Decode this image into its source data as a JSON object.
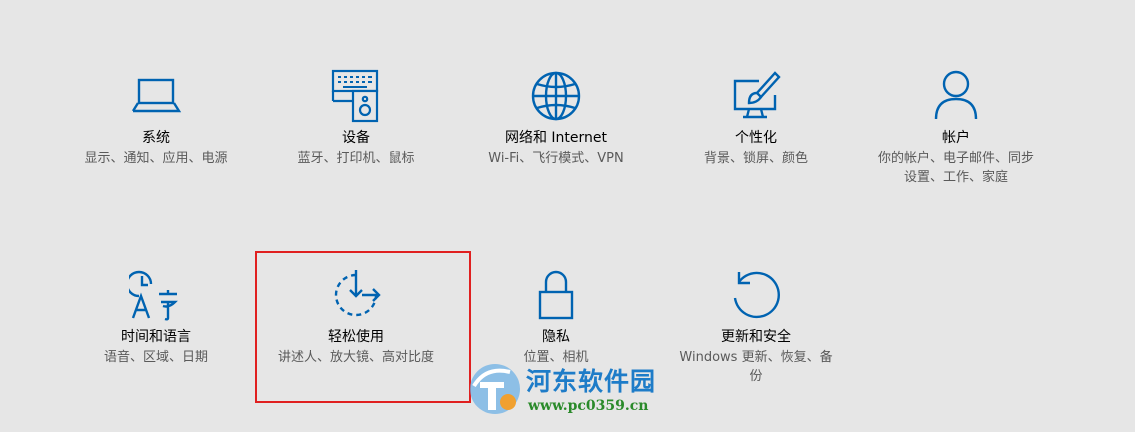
{
  "accent_color": "#0063b1",
  "settings": {
    "system": {
      "icon": "laptop-icon",
      "title": "系统",
      "desc": "显示、通知、应用、电源"
    },
    "devices": {
      "icon": "devices-icon",
      "title": "设备",
      "desc": "蓝牙、打印机、鼠标"
    },
    "network": {
      "icon": "globe-icon",
      "title": "网络和 Internet",
      "desc": "Wi-Fi、飞行模式、VPN"
    },
    "personalization": {
      "icon": "paintbrush-icon",
      "title": "个性化",
      "desc": "背景、锁屏、颜色"
    },
    "accounts": {
      "icon": "person-icon",
      "title": "帐户",
      "desc": "你的帐户、电子邮件、同步设置、工作、家庭"
    },
    "time_language": {
      "icon": "time-language-icon",
      "title": "时间和语言",
      "desc": "语音、区域、日期"
    },
    "ease_of_access": {
      "icon": "ease-of-access-icon",
      "title": "轻松使用",
      "desc": "讲述人、放大镜、高对比度"
    },
    "privacy": {
      "icon": "lock-icon",
      "title": "隐私",
      "desc": "位置、相机"
    },
    "update_security": {
      "icon": "refresh-icon",
      "title": "更新和安全",
      "desc": "Windows 更新、恢复、备份"
    }
  },
  "watermark": {
    "name": "河东软件园",
    "url": "www.pc0359.cn"
  }
}
